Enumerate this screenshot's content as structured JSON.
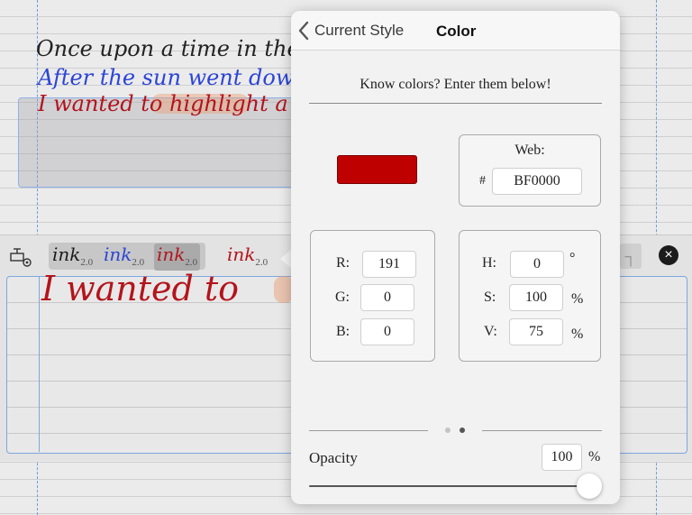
{
  "notebook": {
    "lines": [
      "Once upon a time in the We",
      "After the sun went down",
      "I wanted to highlight a wo"
    ],
    "big_ink_text": "I wanted to"
  },
  "toolbar": {
    "settings_icon": "settings-gear-icon",
    "ink_presets": [
      {
        "label": "ink",
        "version": "2.0",
        "color": "#1a1a1a"
      },
      {
        "label": "ink",
        "version": "2.0",
        "color": "#2b44d6"
      },
      {
        "label": "ink",
        "version": "2.0",
        "color": "#b3141c"
      },
      {
        "label": "ink",
        "version": "2.0",
        "color": "#b3141c"
      }
    ],
    "close_icon": "close-icon",
    "close_glyph": "×"
  },
  "popover": {
    "back_label": "Current Style",
    "title": "Color",
    "hint": "Know colors? Enter them below!",
    "swatch_color": "#BF0000",
    "web": {
      "label": "Web:",
      "hash": "#",
      "value": "BF0000"
    },
    "rgb": {
      "r_label": "R:",
      "r": "191",
      "g_label": "G:",
      "g": "0",
      "b_label": "B:",
      "b": "0"
    },
    "hsv": {
      "h_label": "H:",
      "h": "0",
      "h_unit": "°",
      "s_label": "S:",
      "s": "100",
      "s_unit": "%",
      "v_label": "V:",
      "v": "75",
      "v_unit": "%"
    },
    "page_indicator": {
      "pages": 2,
      "current": 2
    },
    "opacity": {
      "label": "Opacity",
      "value": "100",
      "unit": "%",
      "level": 1.0
    }
  }
}
